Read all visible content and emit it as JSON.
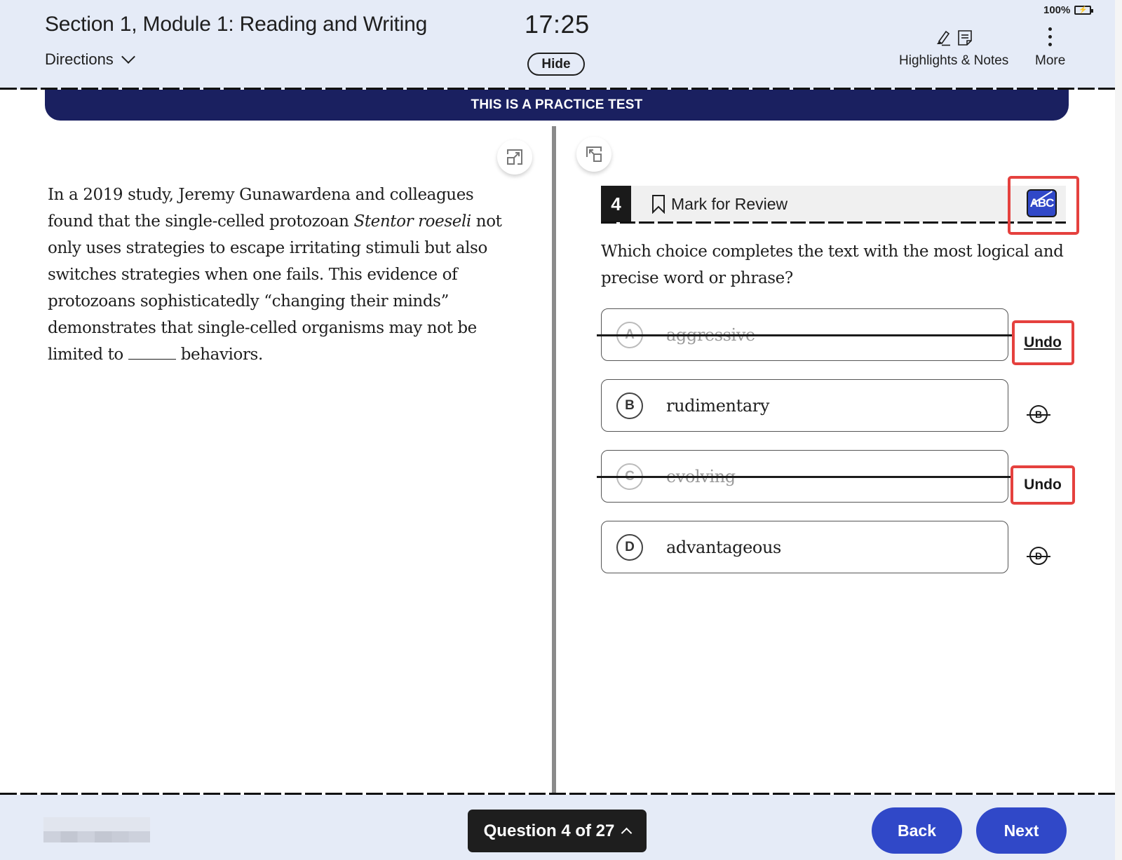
{
  "header": {
    "section_title": "Section 1, Module 1: Reading and Writing",
    "directions_label": "Directions",
    "timer": "17:25",
    "hide_label": "Hide",
    "battery_percent": "100%",
    "highlights_notes_label": "Highlights & Notes",
    "more_label": "More"
  },
  "banner": {
    "text": "THIS IS A PRACTICE TEST"
  },
  "passage": {
    "part1": "In a 2019 study, Jeremy Gunawardena and colleagues found that the single-celled protozoan ",
    "italic": "Stentor roeseli",
    "part2": " not only uses strategies to escape irritating stimuli but also switches strategies when one fails. This evidence of protozoans sophisticatedly “changing their minds” demonstrates that single-celled organisms may not be limited to ",
    "part3": " behaviors."
  },
  "question": {
    "number": "4",
    "mark_for_review_label": "Mark for Review",
    "eliminator_label": "ABC",
    "eliminator_active": true,
    "prompt": "Which choice completes the text with the most logical and precise word or phrase?",
    "options": [
      {
        "letter": "A",
        "text": "aggressive",
        "crossed_out": true,
        "action_label": "Undo"
      },
      {
        "letter": "B",
        "text": "rudimentary",
        "crossed_out": false,
        "action_label": "B"
      },
      {
        "letter": "C",
        "text": "evolving",
        "crossed_out": true,
        "action_label": "Undo"
      },
      {
        "letter": "D",
        "text": "advantageous",
        "crossed_out": false,
        "action_label": "D"
      }
    ]
  },
  "footer": {
    "question_nav_label": "Question 4 of 27",
    "back_label": "Back",
    "next_label": "Next"
  },
  "colors": {
    "header_bg": "#e5ebf7",
    "banner_bg": "#1a2060",
    "primary_button": "#3048c8",
    "highlight_box": "#e5413e",
    "question_nav_bg": "#1e1e1e"
  }
}
